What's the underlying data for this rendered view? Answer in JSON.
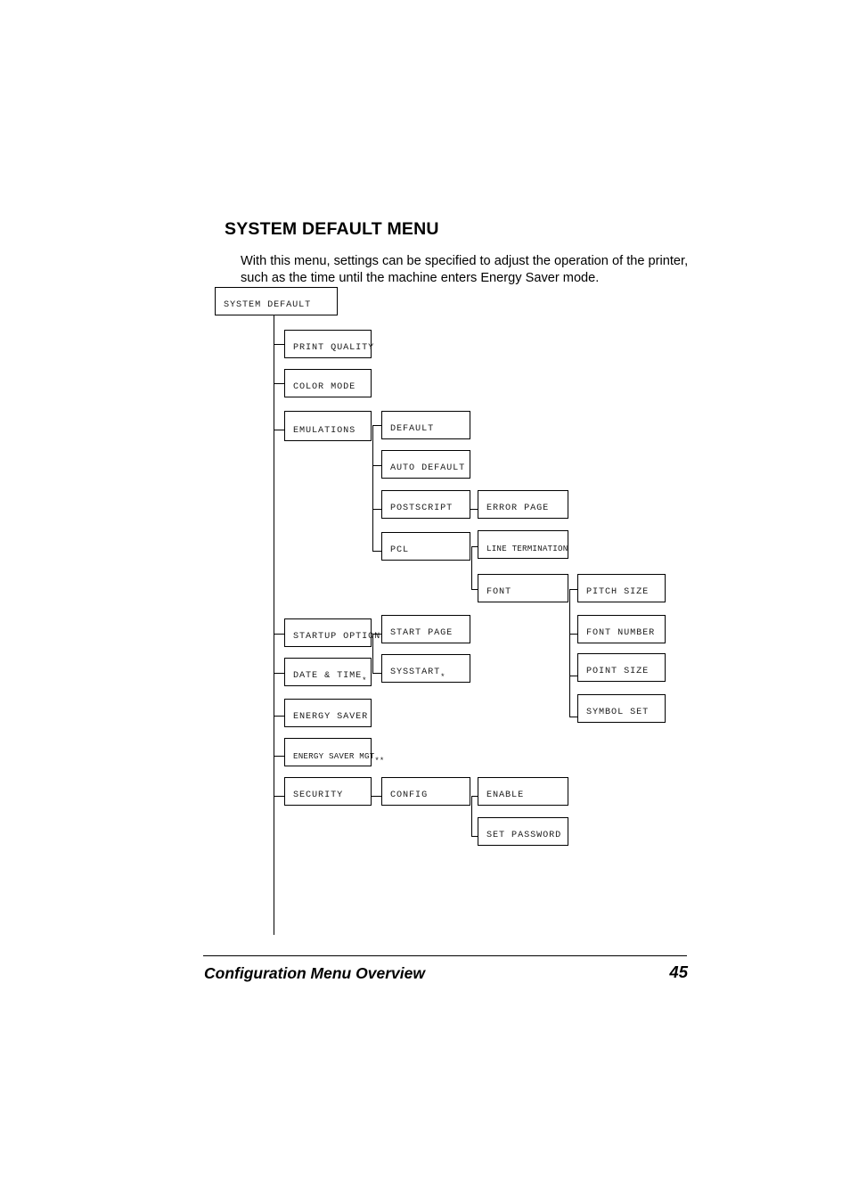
{
  "page": {
    "section_title": "SYSTEM DEFAULT MENU",
    "intro_text": "With this menu, settings can be specified to adjust the operation of the printer, such as the time until the machine enters Energy Saver mode.",
    "footer_title": "Configuration Menu Overview",
    "page_number": "45",
    "line_color": "#000000",
    "text_color": "#1a1a1a"
  },
  "diagram": {
    "type": "menu-tree",
    "root": "SYSTEM DEFAULT",
    "nodes": {
      "root": "SYSTEM DEFAULT",
      "print_quality": "PRINT QUALITY",
      "color_mode": "COLOR MODE",
      "emulations": "EMULATIONS",
      "emu_default": "DEFAULT",
      "emu_auto_default": "AUTO DEFAULT",
      "emu_postscript": "POSTSCRIPT",
      "ps_error_page": "ERROR PAGE",
      "emu_pcl": "PCL",
      "pcl_line_termination": "LINE TERMINATION",
      "pcl_font": "FONT",
      "font_pitch_size": "PITCH SIZE",
      "font_font_number": "FONT NUMBER",
      "font_point_size": "POINT SIZE",
      "font_symbol_set": "SYMBOL SET",
      "startup_options": "STARTUP OPTIONS",
      "startup_start_page": "START PAGE",
      "startup_sysstart": "SYSSTART",
      "startup_sysstart_mark": "*",
      "date_time": "DATE & TIME",
      "date_time_mark": "*",
      "energy_saver": "ENERGY SAVER",
      "energy_saver_mgt": "ENERGY SAVER MGT",
      "energy_saver_mgt_mark": "**",
      "security": "SECURITY",
      "security_config": "CONFIG",
      "config_enable": "ENABLE",
      "config_set_password": "SET PASSWORD"
    }
  }
}
